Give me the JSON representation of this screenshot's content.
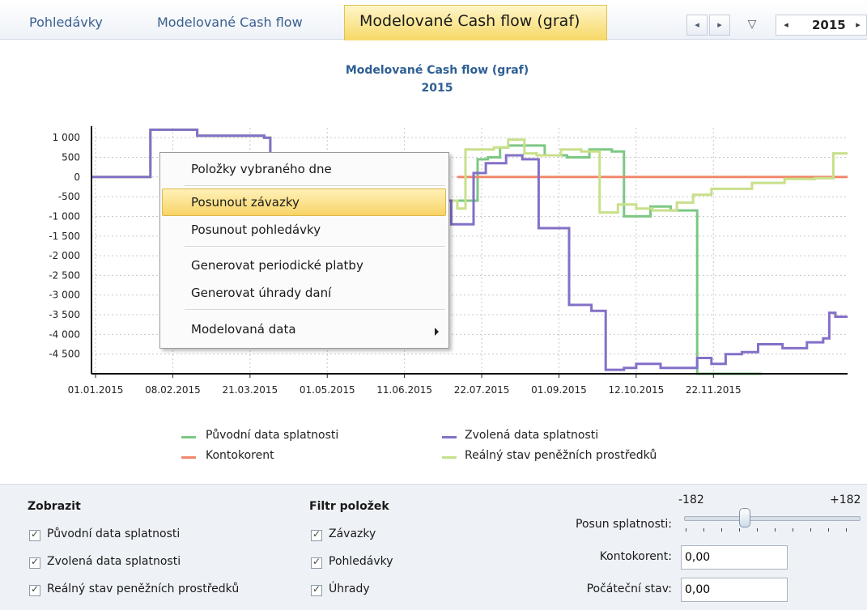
{
  "tabs": [
    "Pohledávky",
    "Modelované Cash flow",
    "Modelované Cash flow (graf)"
  ],
  "active_tab": "Modelované Cash flow (graf)",
  "nav": {
    "prev": "◂",
    "next": "▸",
    "filter": "▽"
  },
  "year_selector": {
    "prev": "◂",
    "value": "2015",
    "next": "▸"
  },
  "chart_data": {
    "type": "line",
    "title": "Modelované Cash flow (graf)",
    "subtitle": "2015",
    "xlabel": "",
    "ylabel": "",
    "x_ticks": [
      "01.01.2015",
      "08.02.2015",
      "21.03.2015",
      "01.05.2015",
      "11.06.2015",
      "22.07.2015",
      "01.09.2015",
      "12.10.2015",
      "22.11.2015"
    ],
    "y_ticks": [
      "1 000",
      "500",
      "0",
      "-500",
      "-1 000",
      "-1 500",
      "-2 000",
      "-2 500",
      "-3 000",
      "-3 500",
      "-4 000",
      "-4 500"
    ],
    "ylim": [
      -5000,
      1250
    ],
    "xlim_days": [
      0,
      365
    ],
    "grid": true,
    "legend_position": "bottom",
    "series": [
      {
        "name": "Původní data splatnosti",
        "color": "#7cc884",
        "points": [
          [
            0,
            0
          ],
          [
            29,
            0
          ],
          [
            29,
            1200
          ],
          [
            52,
            1200
          ],
          [
            52,
            1050
          ],
          [
            85,
            1050
          ],
          [
            85,
            1000
          ],
          [
            88,
            1000
          ],
          [
            88,
            -600
          ],
          [
            190,
            -600
          ],
          [
            190,
            450
          ],
          [
            195,
            450
          ],
          [
            195,
            500
          ],
          [
            201,
            500
          ],
          [
            201,
            750
          ],
          [
            205,
            750
          ],
          [
            205,
            800
          ],
          [
            223,
            800
          ],
          [
            223,
            550
          ],
          [
            234,
            550
          ],
          [
            234,
            500
          ],
          [
            245,
            500
          ],
          [
            245,
            700
          ],
          [
            256,
            700
          ],
          [
            256,
            650
          ],
          [
            262,
            650
          ],
          [
            262,
            -1000
          ],
          [
            275,
            -1000
          ],
          [
            275,
            -750
          ],
          [
            285,
            -750
          ],
          [
            285,
            -850
          ],
          [
            298,
            -850
          ],
          [
            298,
            -5000
          ],
          [
            330,
            -5000
          ]
        ]
      },
      {
        "name": "Zvolená data splatnosti",
        "color": "#8470c8",
        "points": [
          [
            0,
            0
          ],
          [
            29,
            0
          ],
          [
            29,
            1200
          ],
          [
            52,
            1200
          ],
          [
            52,
            1050
          ],
          [
            85,
            1050
          ],
          [
            85,
            1000
          ],
          [
            88,
            1000
          ],
          [
            88,
            -600
          ],
          [
            177,
            -600
          ],
          [
            177,
            -1200
          ],
          [
            188,
            -1200
          ],
          [
            188,
            100
          ],
          [
            194,
            100
          ],
          [
            194,
            350
          ],
          [
            204,
            350
          ],
          [
            204,
            550
          ],
          [
            212,
            550
          ],
          [
            212,
            450
          ],
          [
            220,
            450
          ],
          [
            220,
            -1300
          ],
          [
            235,
            -1300
          ],
          [
            235,
            -3250
          ],
          [
            246,
            -3250
          ],
          [
            246,
            -3400
          ],
          [
            253,
            -3400
          ],
          [
            253,
            -4900
          ],
          [
            262,
            -4900
          ],
          [
            262,
            -4850
          ],
          [
            268,
            -4850
          ],
          [
            268,
            -4750
          ],
          [
            280,
            -4750
          ],
          [
            280,
            -4850
          ],
          [
            298,
            -4850
          ],
          [
            298,
            -4600
          ],
          [
            305,
            -4600
          ],
          [
            305,
            -4750
          ],
          [
            312,
            -4750
          ],
          [
            312,
            -4500
          ],
          [
            320,
            -4500
          ],
          [
            320,
            -4450
          ],
          [
            328,
            -4450
          ],
          [
            328,
            -4250
          ],
          [
            340,
            -4250
          ],
          [
            340,
            -4350
          ],
          [
            352,
            -4350
          ],
          [
            352,
            -4200
          ],
          [
            360,
            -4200
          ],
          [
            360,
            -4100
          ],
          [
            363,
            -4100
          ],
          [
            363,
            -3450
          ],
          [
            366,
            -3450
          ],
          [
            366,
            -3550
          ],
          [
            372,
            -3550
          ]
        ]
      },
      {
        "name": "Kontokorent",
        "color": "#f0886a",
        "points": [
          [
            180,
            0
          ],
          [
            372,
            0
          ]
        ]
      },
      {
        "name": "Reálný stav peněžních prostředků",
        "color": "#c8e08a",
        "points": [
          [
            0,
            0
          ],
          [
            29,
            0
          ],
          [
            29,
            1200
          ],
          [
            52,
            1200
          ],
          [
            52,
            1050
          ],
          [
            85,
            1050
          ],
          [
            85,
            1000
          ],
          [
            88,
            1000
          ],
          [
            88,
            -600
          ],
          [
            180,
            -600
          ],
          [
            180,
            -800
          ],
          [
            184,
            -800
          ],
          [
            184,
            700
          ],
          [
            198,
            700
          ],
          [
            198,
            750
          ],
          [
            205,
            750
          ],
          [
            205,
            950
          ],
          [
            213,
            950
          ],
          [
            213,
            600
          ],
          [
            219,
            600
          ],
          [
            219,
            550
          ],
          [
            231,
            550
          ],
          [
            231,
            700
          ],
          [
            241,
            700
          ],
          [
            241,
            650
          ],
          [
            250,
            650
          ],
          [
            250,
            -900
          ],
          [
            259,
            -900
          ],
          [
            259,
            -700
          ],
          [
            268,
            -700
          ],
          [
            268,
            -800
          ],
          [
            276,
            -800
          ],
          [
            276,
            -850
          ],
          [
            288,
            -850
          ],
          [
            288,
            -650
          ],
          [
            296,
            -650
          ],
          [
            296,
            -450
          ],
          [
            305,
            -450
          ],
          [
            305,
            -300
          ],
          [
            325,
            -300
          ],
          [
            325,
            -150
          ],
          [
            341,
            -150
          ],
          [
            341,
            -50
          ],
          [
            356,
            -50
          ],
          [
            356,
            -30
          ],
          [
            365,
            -30
          ],
          [
            365,
            600
          ],
          [
            372,
            600
          ]
        ]
      }
    ]
  },
  "context_menu": {
    "items": [
      "Položky vybraného dne",
      "Posunout závazky",
      "Posunout pohledávky",
      "Generovat periodické platby",
      "Generovat úhrady daní",
      "Modelovaná data"
    ],
    "highlighted": "Posunout závazky"
  },
  "bottom": {
    "zobrazit_header": "Zobrazit",
    "zobrazit": [
      "Původní data splatnosti",
      "Zvolená data splatnosti",
      "Reálný stav peněžních prostředků"
    ],
    "filtr_header": "Filtr položek",
    "filtr": [
      "Závazky",
      "Pohledávky",
      "Úhrady"
    ],
    "slider": {
      "min": "-182",
      "max": "+182",
      "label": "Posun splatnosti:",
      "value": -10
    },
    "kontokorent_label": "Kontokorent:",
    "kontokorent_value": "0,00",
    "pocatecni_label": "Počáteční stav:",
    "pocatecni_value": "0,00"
  }
}
